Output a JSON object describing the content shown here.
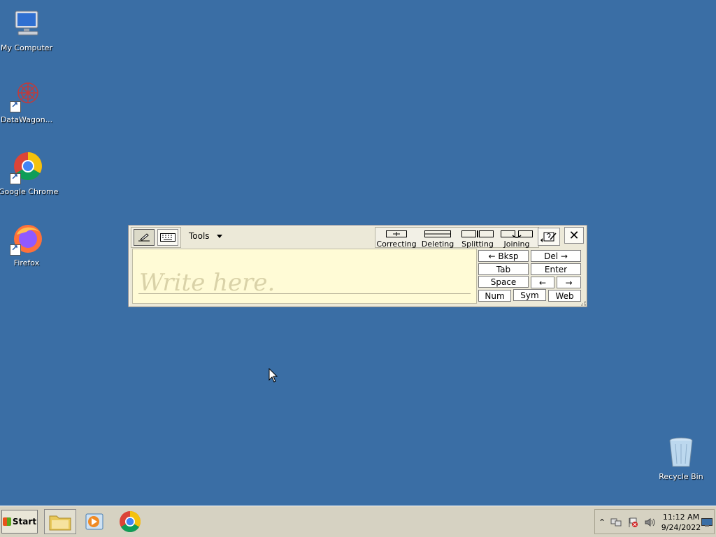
{
  "desktop": {
    "icons": [
      {
        "label": "My Computer"
      },
      {
        "label": "DataWagon..."
      },
      {
        "label": "Google Chrome"
      },
      {
        "label": "Firefox"
      },
      {
        "label": "Recycle Bin"
      }
    ]
  },
  "input_panel": {
    "toolbar": {
      "tools_label": "Tools",
      "gestures": [
        "Correcting",
        "Deleting",
        "Splitting",
        "Joining"
      ],
      "close_glyph": "✕"
    },
    "write_hint": "Write here.",
    "keys": {
      "bksp": "←  Bksp",
      "del": "Del  →",
      "tab": "Tab",
      "enter": "Enter",
      "space": "Space",
      "left": "←",
      "right": "→",
      "num": "Num",
      "sym": "Sym",
      "web": "Web"
    }
  },
  "taskbar": {
    "start_label": "Start",
    "clock_time": "11:12 AM",
    "clock_date": "9/24/2022"
  }
}
